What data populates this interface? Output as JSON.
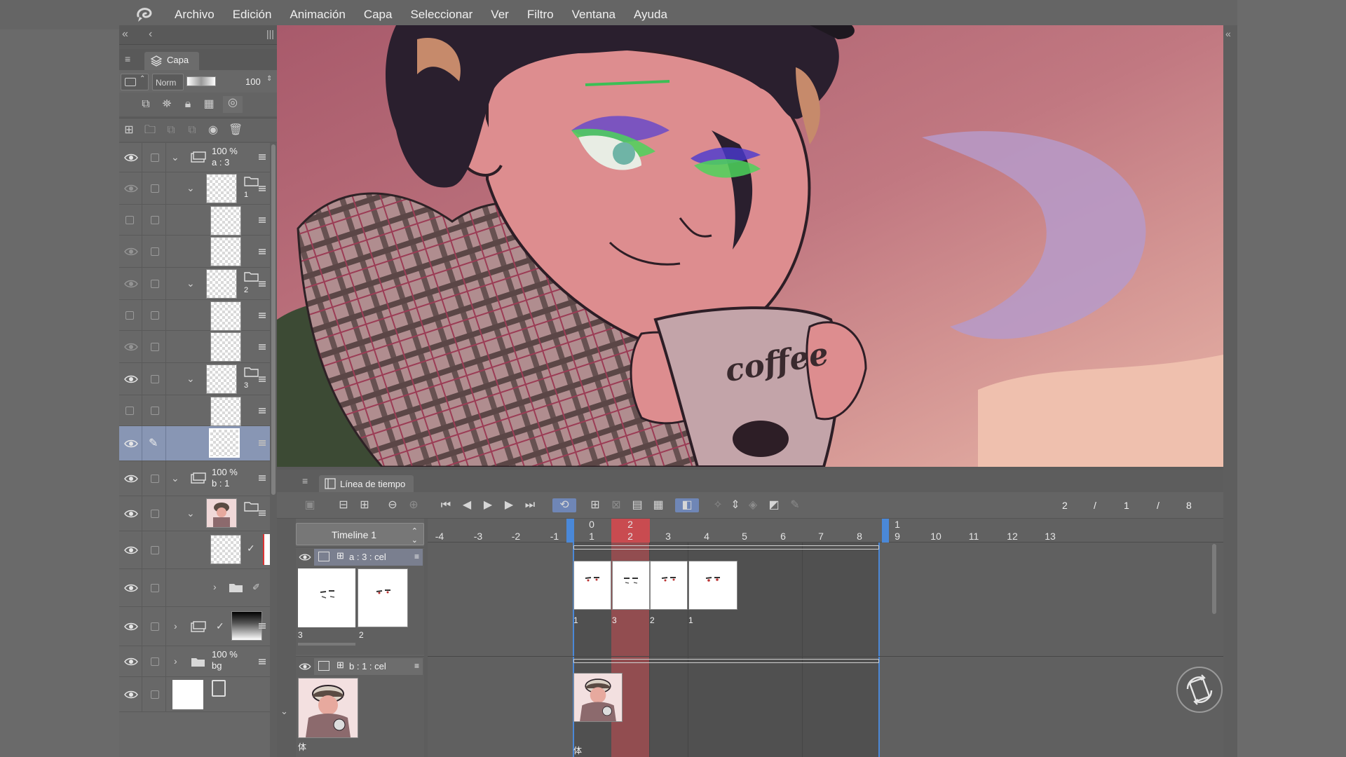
{
  "menubar": {
    "items": [
      "Archivo",
      "Edición",
      "Animación",
      "Capa",
      "Seleccionar",
      "Ver",
      "Filtro",
      "Ventana",
      "Ayuda"
    ]
  },
  "layer_panel": {
    "tab_label": "Capa",
    "blend_mode": "Norm",
    "opacity": "100",
    "layers": [
      {
        "pct": "100 %",
        "name": "a : 3"
      },
      {
        "pct": "100 %",
        "name": "b : 1"
      },
      {
        "pct": "100 %",
        "name": "bg"
      }
    ],
    "sub_labels": [
      "1",
      "2",
      "3"
    ]
  },
  "timeline": {
    "tab_label": "Línea de tiempo",
    "timeline_name": "Timeline 1",
    "frame_counter": {
      "current": "2",
      "sep1": "/",
      "total": "1",
      "sep2": "/",
      "end": "8"
    },
    "ruler_top": [
      "0",
      "2",
      "1"
    ],
    "ruler_bottom": [
      "-4",
      "-3",
      "-2",
      "-1",
      "1",
      "2",
      "3",
      "4",
      "5",
      "6",
      "7",
      "8",
      "9",
      "10",
      "11",
      "12",
      "13"
    ],
    "tracks": [
      {
        "name": "a : 3 : cel",
        "thumb_labels": [
          "3",
          "2"
        ],
        "cel_labels": [
          "1",
          "3",
          "2",
          "1"
        ]
      },
      {
        "name": "b : 1 : cel",
        "thumb_label": "体",
        "cel_label": "体"
      }
    ]
  },
  "canvas": {
    "mug_text": "coffee"
  },
  "colors": {
    "accent_playhead": "#c94b50",
    "accent_active": "#6f86b6",
    "selected_layer": "#8896b4"
  }
}
